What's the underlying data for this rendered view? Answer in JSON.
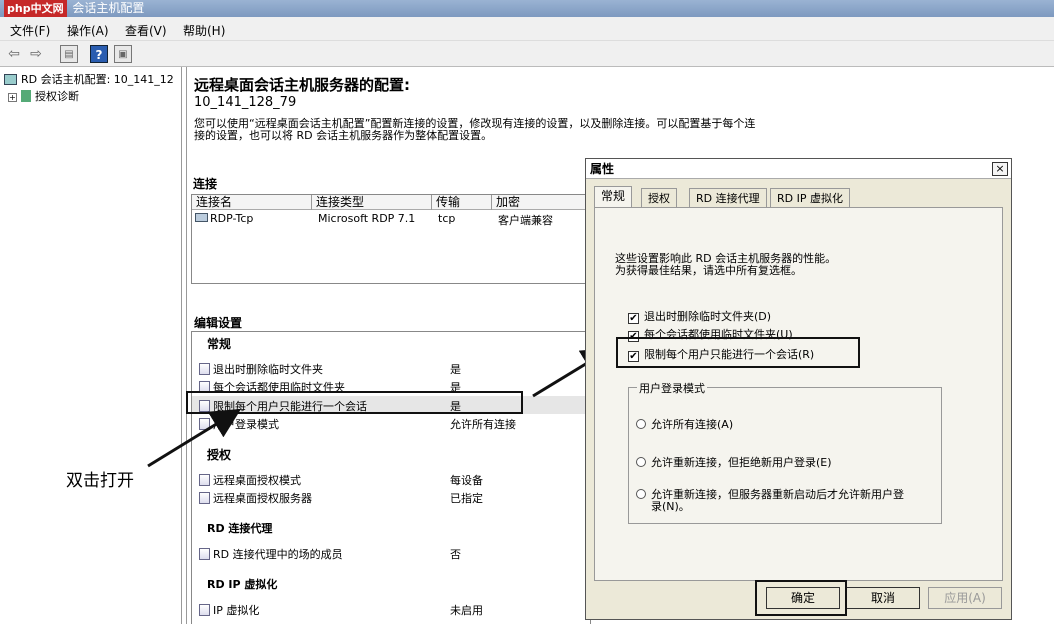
{
  "window": {
    "title": "会话主机配置",
    "logo": "php中文网"
  },
  "menu": [
    "文件(F)",
    "操作(A)",
    "查看(V)",
    "帮助(H)"
  ],
  "toolbar_icons": [
    "back-icon",
    "forward-icon",
    "console-tree-icon",
    "help-icon",
    "properties-icon"
  ],
  "tree": {
    "root": "RD 会话主机配置: 10_141_12",
    "child": "授权诊断"
  },
  "main": {
    "heading": "远程桌面会话主机服务器的配置:",
    "server": "10_141_128_79",
    "description_line1": "您可以使用“远程桌面会话主机配置”配置新连接的设置，修改现有连接的设置，以及删除连接。可以配置基于每个连",
    "description_line2": "接的设置，也可以将 RD 会话主机服务器作为整体配置设置。",
    "connections_title": "连接",
    "columns": [
      "连接名",
      "连接类型",
      "传输",
      "加密"
    ],
    "connection_row": [
      "RDP-Tcp",
      "Microsoft RDP 7.1",
      "tcp",
      "客户端兼容"
    ],
    "edit_settings_title": "编辑设置",
    "groups": {
      "general": "常规",
      "licensing": "授权",
      "broker": "RD 连接代理",
      "ipv": "RD IP 虚拟化"
    },
    "settings": [
      {
        "label": "退出时删除临时文件夹",
        "value": "是"
      },
      {
        "label": "每个会话都使用临时文件夹",
        "value": "是"
      },
      {
        "label": "限制每个用户只能进行一个会话",
        "value": "是"
      },
      {
        "label": "用户登录模式",
        "value": "允许所有连接"
      },
      {
        "label": "远程桌面授权模式",
        "value": "每设备"
      },
      {
        "label": "远程桌面授权服务器",
        "value": "已指定"
      },
      {
        "label": "RD 连接代理中的场的成员",
        "value": "否"
      },
      {
        "label": "IP 虚拟化",
        "value": "未启用"
      }
    ]
  },
  "annotation": "双击打开",
  "dialog": {
    "title": "属性",
    "close": "×",
    "tabs": [
      "常规",
      "授权",
      "RD 连接代理",
      "RD IP 虚拟化"
    ],
    "desc_line1": "这些设置影响此 RD 会话主机服务器的性能。",
    "desc_line2": "为获得最佳结果，请选中所有复选框。",
    "checkboxes": [
      {
        "label": "退出时删除临时文件夹(D)",
        "checked": true
      },
      {
        "label": "每个会话都使用临时文件夹(U)",
        "checked": true
      },
      {
        "label": "限制每个用户只能进行一个会话(R)",
        "checked": true
      }
    ],
    "check_mark": "✔",
    "logon_group": "用户登录模式",
    "radios": [
      {
        "label": "允许所有连接(A)"
      },
      {
        "label": "允许重新连接，但拒绝新用户登录(E)"
      },
      {
        "label_line1": "允许重新连接，但服务器重新启动后才允许新用户登",
        "label_line2": "录(N)。"
      }
    ],
    "buttons": {
      "ok": "确定",
      "cancel": "取消",
      "apply": "应用(A)"
    }
  }
}
